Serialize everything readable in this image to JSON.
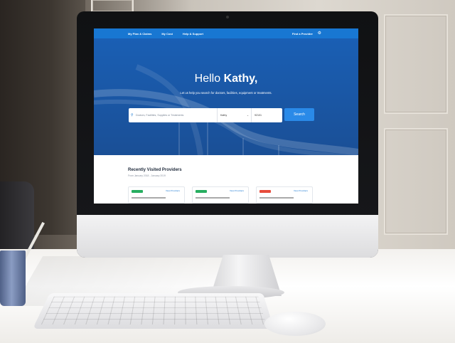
{
  "nav": {
    "items": [
      "My Plan & Claims",
      "My Cost",
      "Help & Support"
    ],
    "right": "Find a Provider"
  },
  "hero": {
    "greeting": "Hello",
    "name": "Kathy,",
    "subtitle": "Let us help you search for doctors, facilities, equipment or treatments."
  },
  "search": {
    "placeholder": "Doctors, Facilities, Supplies or Treatments",
    "member": "Kathy",
    "zip": "92101",
    "button": "Search"
  },
  "recent": {
    "title": "Recently Visited Providers",
    "date_range": "From January 2018 - January 2019",
    "cards": [
      {
        "link": "View Providers",
        "tag_color": "#27ae60"
      },
      {
        "link": "View Providers",
        "tag_color": "#27ae60"
      },
      {
        "link": "View Providers",
        "tag_color": "#e74c3c"
      }
    ]
  },
  "colors": {
    "primary": "#1877d2",
    "hero": "#1a5fb4",
    "button": "#2a8ae8"
  },
  "icons": {
    "search": "search-icon",
    "settings": "gear-icon",
    "dropdown": "chevron-down-icon"
  }
}
